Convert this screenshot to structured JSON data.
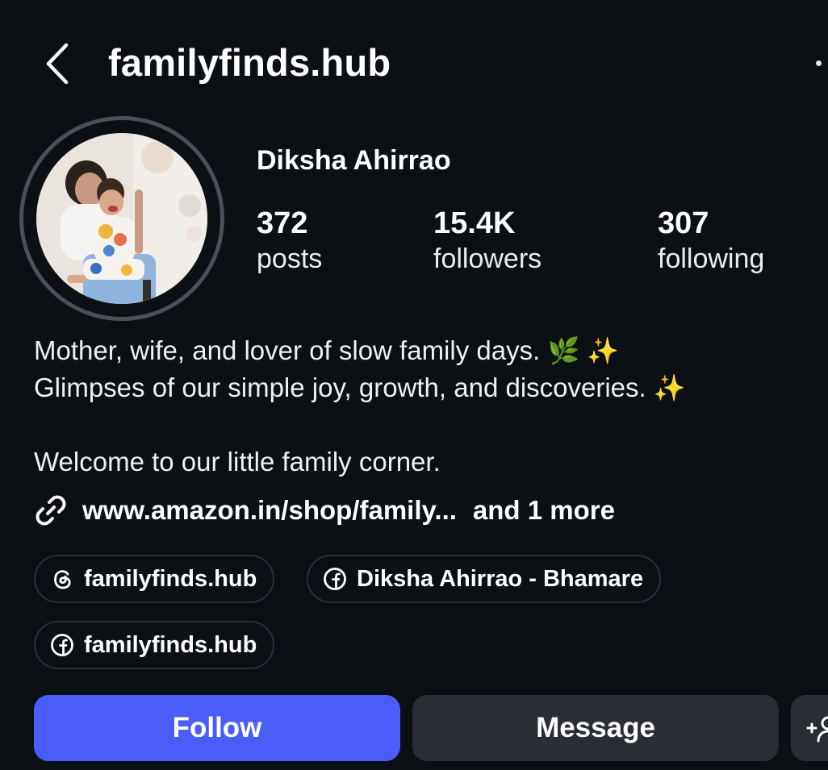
{
  "header": {
    "title": "familyfinds.hub",
    "back_icon": "chevron-left-icon",
    "more_icon": "more-icon"
  },
  "profile": {
    "name": "Diksha Ahirrao",
    "avatar_icon": "profile-photo",
    "stats": {
      "posts": {
        "value": "372",
        "label": "posts"
      },
      "followers": {
        "value": "15.4K",
        "label": "followers"
      },
      "following": {
        "value": "307",
        "label": "following"
      }
    }
  },
  "bio": {
    "line1": "Mother, wife, and lover of slow family days.",
    "line1_emoji": "🌿 ✨",
    "line2": "Glimpses of our simple joy, growth, and discoveries.",
    "line2_emoji": "✨",
    "line3": "Welcome to our little family corner."
  },
  "link": {
    "icon": "link-icon",
    "url_text": "www.amazon.in/shop/family...",
    "more_text": "and 1 more"
  },
  "chips": [
    {
      "icon": "threads-icon",
      "label": "familyfinds.hub"
    },
    {
      "icon": "facebook-icon",
      "label": "Diksha Ahirrao - Bhamare"
    },
    {
      "icon": "facebook-icon",
      "label": "familyfinds.hub"
    }
  ],
  "actions": {
    "follow_label": "Follow",
    "message_label": "Message",
    "add_user_icon": "add-user-icon"
  },
  "colors": {
    "background": "#0c0f14",
    "follow_button": "#4a5df9",
    "secondary_button": "#2a2d33",
    "chip_border": "#2c3138"
  }
}
